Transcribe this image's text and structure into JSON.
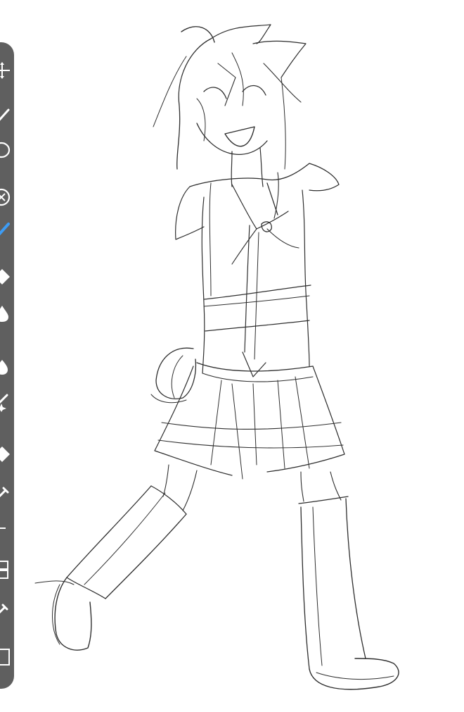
{
  "app": {
    "name": "",
    "accent_color": "#3d9cf5",
    "toolbar_color": "#5f5f5f",
    "stroke_color": "#2e2e2e"
  },
  "toolbar": {
    "tools": [
      {
        "icon": "transform-icon",
        "active": false
      },
      {
        "icon": "pencil-icon",
        "active": false
      },
      {
        "icon": "lasso-selection-icon",
        "active": false
      },
      {
        "icon": "eraser-icon",
        "active": false
      },
      {
        "icon": "brush-icon",
        "active": true
      },
      {
        "icon": "fill-bucket-icon",
        "active": false
      },
      {
        "icon": "blur-icon",
        "active": false
      },
      {
        "icon": "smudge-icon",
        "active": false
      },
      {
        "icon": "sparkle-filter-icon",
        "active": false
      },
      {
        "icon": "fill-icon",
        "active": false
      },
      {
        "icon": "eyedropper-icon",
        "active": false
      },
      {
        "icon": "frame-divider-icon",
        "active": false
      },
      {
        "icon": "layers-icon",
        "active": false
      },
      {
        "icon": "color-picker-icon",
        "active": false
      },
      {
        "icon": "canvas-icon",
        "active": false
      }
    ]
  },
  "canvas": {
    "content": "pencil-sketch-character"
  }
}
